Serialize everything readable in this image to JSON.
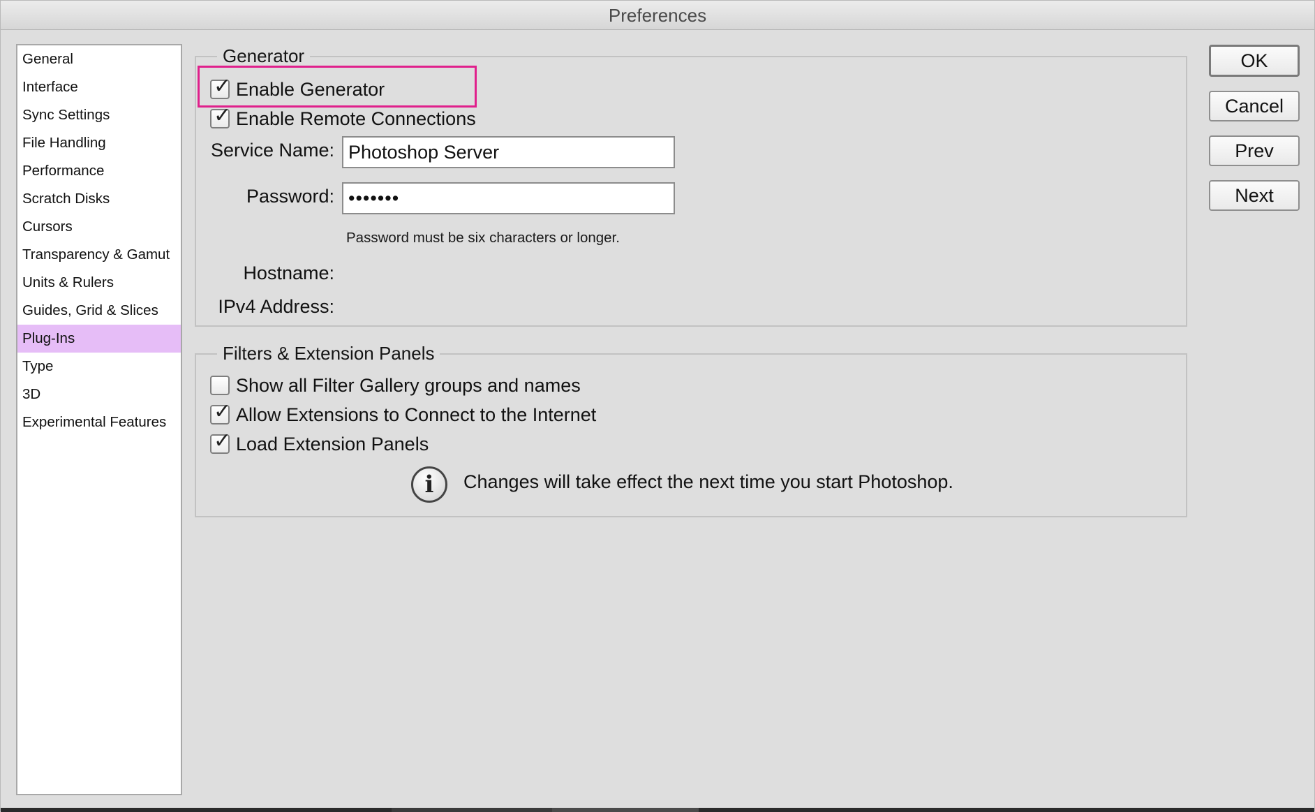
{
  "window": {
    "title": "Preferences"
  },
  "sidebar": {
    "items": [
      {
        "label": "General"
      },
      {
        "label": "Interface"
      },
      {
        "label": "Sync Settings"
      },
      {
        "label": "File Handling"
      },
      {
        "label": "Performance"
      },
      {
        "label": "Scratch Disks"
      },
      {
        "label": "Cursors"
      },
      {
        "label": "Transparency & Gamut"
      },
      {
        "label": "Units & Rulers"
      },
      {
        "label": "Guides, Grid & Slices"
      },
      {
        "label": "Plug-Ins",
        "selected": true
      },
      {
        "label": "Type"
      },
      {
        "label": "3D"
      },
      {
        "label": "Experimental Features"
      }
    ]
  },
  "generator": {
    "title": "Generator",
    "enable_generator": {
      "label": "Enable Generator",
      "checked": true
    },
    "enable_remote": {
      "label": "Enable Remote Connections",
      "checked": true
    },
    "service_name": {
      "label": "Service Name:",
      "value": "Photoshop Server"
    },
    "password": {
      "label": "Password:",
      "value": "•••••••"
    },
    "password_hint": "Password must be six characters or longer.",
    "hostname_label": "Hostname:",
    "ipv4_label": "IPv4 Address:"
  },
  "extensions": {
    "title": "Filters & Extension Panels",
    "show_filter_gallery": {
      "label": "Show all Filter Gallery groups and names",
      "checked": false
    },
    "allow_extensions": {
      "label": "Allow Extensions to Connect to the Internet",
      "checked": true
    },
    "load_panels": {
      "label": "Load Extension Panels",
      "checked": true
    },
    "info_icon": "info-icon",
    "info_text": "Changes will take effect the next time you start Photoshop."
  },
  "buttons": {
    "ok": "OK",
    "cancel": "Cancel",
    "prev": "Prev",
    "next": "Next"
  },
  "colors": {
    "selection": "#e6bdf7",
    "highlight_box": "#e0208c"
  },
  "checkmark_glyph": "✓"
}
